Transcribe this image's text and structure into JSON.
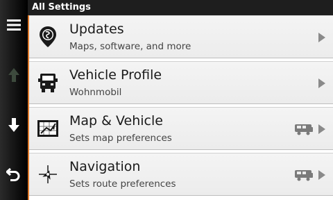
{
  "header": {
    "title": "All Settings"
  },
  "colors": {
    "accent": "#e07a2b",
    "header_bg": "#1e1e1e"
  },
  "rail": {
    "icons": [
      "menu-icon",
      "arrow-up-icon",
      "arrow-down-icon",
      "back-icon"
    ]
  },
  "settings": {
    "items": [
      {
        "title": "Updates",
        "subtitle": "Maps, software, and more",
        "icon": "globe-pin-icon",
        "badge": ""
      },
      {
        "title": "Vehicle Profile",
        "subtitle": "Wohnmobil",
        "icon": "truck-icon",
        "badge": ""
      },
      {
        "title": "Map & Vehicle",
        "subtitle": "Sets map preferences",
        "icon": "map-icon",
        "badge": "rv-icon"
      },
      {
        "title": "Navigation",
        "subtitle": "Sets route preferences",
        "icon": "compass-icon",
        "badge": "rv-icon"
      }
    ]
  }
}
